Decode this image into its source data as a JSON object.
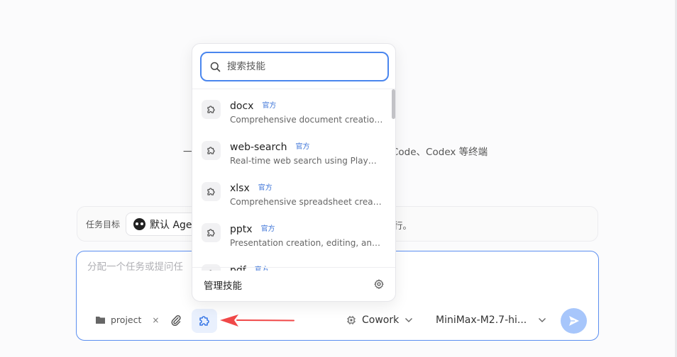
{
  "background": {
    "subtitle_left": "一",
    "subtitle_right": "Code、Codex 等终端"
  },
  "goal_bar": {
    "label": "任务目标",
    "agent": "默认 Age",
    "tail_text": "行。"
  },
  "composer": {
    "placeholder": "分配一个任务或提问任",
    "project_label": "project",
    "project_close": "×",
    "mode_label": "Cowork",
    "model_label": "MiniMax-M2.7-hi..."
  },
  "skills_popup": {
    "search_placeholder": "搜索技能",
    "items": [
      {
        "name": "docx",
        "badge": "官方",
        "desc": "Comprehensive document creation, editing"
      },
      {
        "name": "web-search",
        "badge": "官方",
        "desc": "Real-time web search using Playwright"
      },
      {
        "name": "xlsx",
        "badge": "官方",
        "desc": "Comprehensive spreadsheet creation, editing"
      },
      {
        "name": "pptx",
        "badge": "官方",
        "desc": "Presentation creation, editing, and analysis"
      },
      {
        "name": "pdf",
        "badge": "官方",
        "desc": ""
      }
    ],
    "footer_label": "管理技能"
  },
  "colors": {
    "accent": "#4a86ee",
    "send_button": "#a7c6fb",
    "annotation_arrow": "#f04848"
  }
}
